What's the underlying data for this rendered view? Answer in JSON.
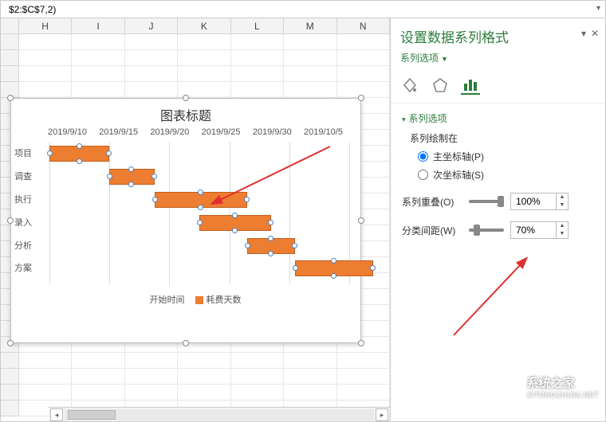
{
  "formula": "$2:$C$7,2)",
  "columns": [
    "",
    "H",
    "I",
    "J",
    "K",
    "L",
    "M",
    "N"
  ],
  "chart": {
    "title": "图表标题",
    "x_ticks": [
      "2019/9/10",
      "2019/9/15",
      "2019/9/20",
      "2019/9/25",
      "2019/9/30",
      "2019/10/5"
    ],
    "categories": [
      "项目",
      "调查",
      "执行",
      "录入",
      "分析",
      "方案"
    ],
    "legend": {
      "s1": "开始时间",
      "s2": "耗费天数"
    }
  },
  "chart_data": {
    "type": "bar",
    "orientation": "horizontal",
    "stacked": true,
    "categories": [
      "项目",
      "调查",
      "执行",
      "录入",
      "分析",
      "方案"
    ],
    "x_axis_type": "date",
    "x_ticks": [
      "2019/9/10",
      "2019/9/15",
      "2019/9/20",
      "2019/9/25",
      "2019/9/30",
      "2019/10/5"
    ],
    "series": [
      {
        "name": "开始时间",
        "role": "offset_start_date",
        "values": [
          "2019/9/10",
          "2019/9/15",
          "2019/9/19",
          "2019/9/23",
          "2019/9/27",
          "2019/10/1"
        ]
      },
      {
        "name": "耗费天数",
        "role": "duration_days",
        "values": [
          5,
          4,
          8,
          6,
          4,
          6
        ]
      }
    ],
    "title": "图表标题"
  },
  "pane": {
    "title": "设置数据系列格式",
    "subtitle": "系列选项",
    "section": "系列选项",
    "plot_on_label": "系列绘制在",
    "primary_axis": "主坐标轴(P)",
    "secondary_axis": "次坐标轴(S)",
    "overlap_label": "系列重叠(O)",
    "overlap_value": "100%",
    "gap_label": "分类间距(W)",
    "gap_value": "70%"
  },
  "watermark": {
    "line1": "系统之家",
    "line2": "XITONGZHIJIA.NET"
  }
}
